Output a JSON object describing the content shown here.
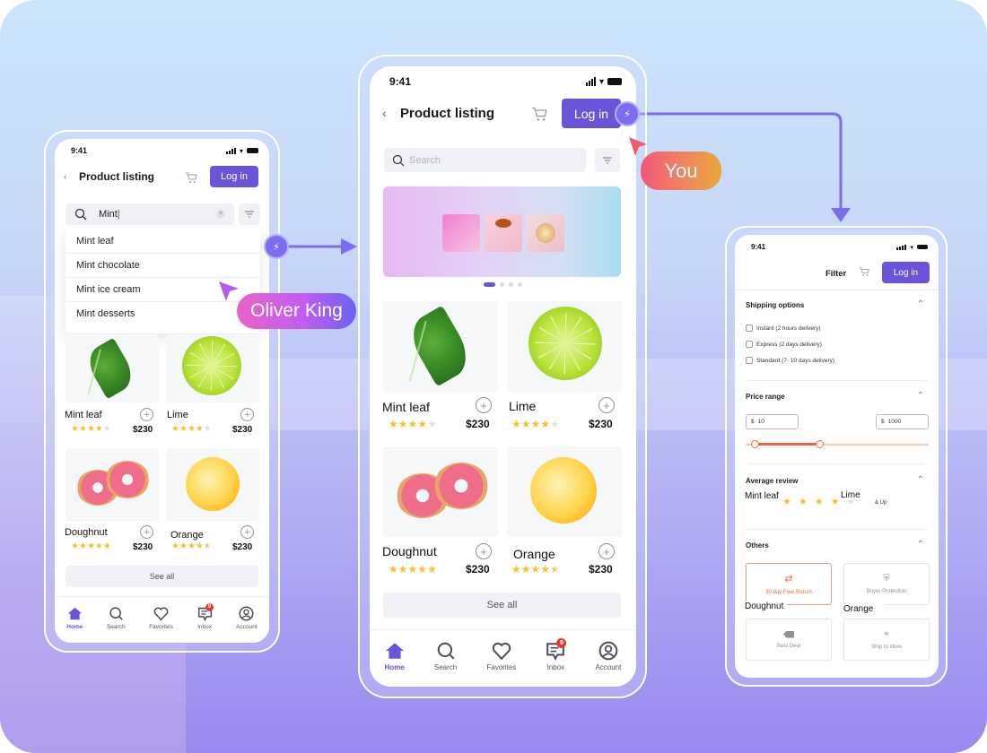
{
  "colors": {
    "accent": "#6a55d8",
    "star": "#f3c230",
    "price_slider": "#f0653c",
    "connector": "#7b6cf0",
    "badge": "#e53935"
  },
  "left_phone": {
    "status_time": "9:41",
    "header": {
      "title": "Product listing",
      "login_label": "Log in"
    },
    "search": {
      "value": "Mint",
      "clear_icon": "clear-icon"
    },
    "suggestions": [
      "Mint leaf",
      "Mint chocolate",
      "Mint ice cream",
      "Mint desserts"
    ],
    "products": [
      {
        "name": "Mint leaf",
        "price": "$230",
        "rating": 4
      },
      {
        "name": "Lime",
        "price": "$230",
        "rating": 4
      },
      {
        "name": "Doughnut",
        "price": "$230",
        "rating": 5
      },
      {
        "name": "Orange",
        "price": "$230",
        "rating": 4.5
      }
    ],
    "see_all_label": "See all",
    "tabs": [
      {
        "label": "Home",
        "icon": "home-icon",
        "active": true
      },
      {
        "label": "Search",
        "icon": "search-icon"
      },
      {
        "label": "Favorites",
        "icon": "heart-icon"
      },
      {
        "label": "Inbox",
        "icon": "inbox-icon",
        "badge": "9"
      },
      {
        "label": "Account",
        "icon": "account-icon"
      }
    ]
  },
  "center_phone": {
    "status_time": "9:41",
    "header": {
      "title": "Product listing",
      "login_label": "Log in"
    },
    "search": {
      "placeholder": "Search"
    },
    "carousel": {
      "pages": 4,
      "current": 1
    },
    "products": [
      {
        "name": "Mint leaf",
        "price": "$230",
        "rating": 4
      },
      {
        "name": "Lime",
        "price": "$230",
        "rating": 4
      },
      {
        "name": "Doughnut",
        "price": "$230",
        "rating": 5
      },
      {
        "name": "Orange",
        "price": "$230",
        "rating": 4.5
      }
    ],
    "see_all_label": "See all",
    "tabs": [
      {
        "label": "Home",
        "icon": "home-icon",
        "active": true
      },
      {
        "label": "Search",
        "icon": "search-icon"
      },
      {
        "label": "Favorites",
        "icon": "heart-icon"
      },
      {
        "label": "Inbox",
        "icon": "inbox-icon",
        "badge": "9"
      },
      {
        "label": "Account",
        "icon": "account-icon"
      }
    ]
  },
  "right_phone": {
    "status_time": "9:41",
    "header": {
      "title": "Filter",
      "login_label": "Log in"
    },
    "shipping": {
      "title": "Shipping options",
      "options": [
        "Instant (2 hours delivery)",
        "Express (2 days delivery)",
        "Standard (7- 10 days delivery)"
      ]
    },
    "price": {
      "title": "Price range",
      "currency": "$",
      "min": "10",
      "max": "1000",
      "slider_low_fraction": 0.05,
      "slider_high_fraction": 0.4
    },
    "review": {
      "title": "Average review",
      "rating": 4,
      "suffix": "& Up",
      "overlay_labels": [
        "Mint leaf",
        "Lime"
      ]
    },
    "others": {
      "title": "Others",
      "options": [
        {
          "label": "30-day Free Return",
          "icon": "return-icon",
          "selected": true
        },
        {
          "label": "Buyer Protection",
          "icon": "shield-icon"
        },
        {
          "label": "Best Deal",
          "icon": "tag-icon"
        },
        {
          "label": "Ship to store",
          "icon": "location-pin-icon"
        }
      ],
      "overlay_labels": [
        "Doughnut",
        "Orange"
      ]
    }
  },
  "collaborators": {
    "oliver": "Oliver King",
    "you": "You"
  }
}
